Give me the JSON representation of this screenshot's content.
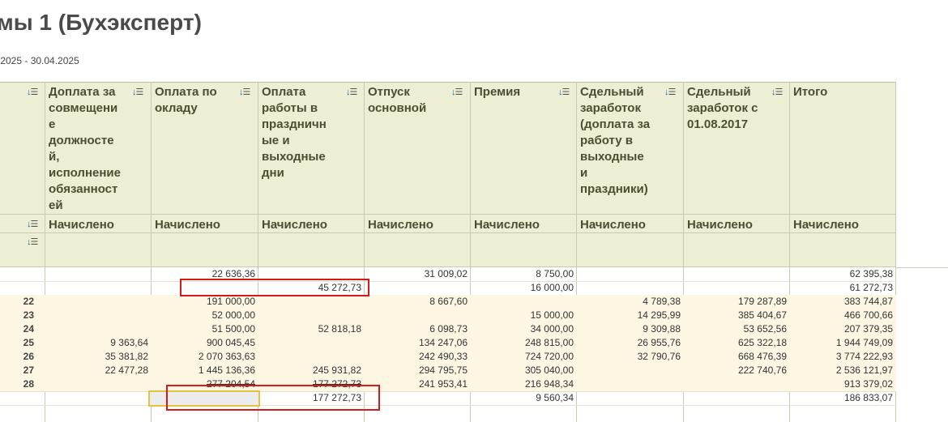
{
  "report": {
    "title": "мы 1 (Бухэксперт)",
    "period": ".2025 - 30.04.2025"
  },
  "columns": [
    {
      "label": "Доплата за\nсовмещени\nе\nдолжносте\nй,\nисполнение\nобязанност\nей",
      "sub": "Начислено"
    },
    {
      "label": "Оплата по\nокладу",
      "sub": "Начислено"
    },
    {
      "label": "Оплата\nработы в\nпраздничн\nые и\nвыходные\nдни",
      "sub": "Начислено"
    },
    {
      "label": "Отпуск\nосновной",
      "sub": "Начислено"
    },
    {
      "label": "Премия",
      "sub": "Начислено"
    },
    {
      "label": "Сдельный\nзаработок\n(доплата за\nработу в\nвыходные\nи\nпраздники)",
      "sub": "Начислено"
    },
    {
      "label": "Сдельный\nзаработок с\n01.08.2017",
      "sub": "Начислено"
    },
    {
      "label": "Итого",
      "sub": "Начислено"
    }
  ],
  "rows": [
    {
      "num": "",
      "values": [
        "",
        "22 636,36",
        "",
        "31 009,02",
        "8 750,00",
        "",
        "",
        "62 395,38"
      ]
    },
    {
      "num": "",
      "values": [
        "",
        "",
        "45 272,73",
        "",
        "16 000,00",
        "",
        "",
        "61 272,73"
      ]
    },
    {
      "num": "22",
      "values": [
        "",
        "191 000,00",
        "",
        "8 667,60",
        "",
        "4 789,38",
        "179 287,89",
        "383 744,87"
      ]
    },
    {
      "num": "23",
      "values": [
        "",
        "52 000,00",
        "",
        "",
        "15 000,00",
        "14 295,99",
        "385 404,67",
        "466 700,66"
      ]
    },
    {
      "num": "24",
      "values": [
        "",
        "51 500,00",
        "52 818,18",
        "6 098,73",
        "34 000,00",
        "9 309,88",
        "53 652,56",
        "207 379,35"
      ]
    },
    {
      "num": "25",
      "values": [
        "9 363,64",
        "900 045,45",
        "",
        "134 247,06",
        "248 815,00",
        "26 955,76",
        "625 322,18",
        "1 944 749,09"
      ]
    },
    {
      "num": "26",
      "values": [
        "35 381,82",
        "2 070 363,63",
        "",
        "242 490,33",
        "724 720,00",
        "32 790,76",
        "668 476,39",
        "3 774 222,93"
      ]
    },
    {
      "num": "27",
      "values": [
        "22 477,28",
        "1 445 136,36",
        "245 931,82",
        "294 795,75",
        "305 040,00",
        "",
        "222 740,76",
        "2 536 121,97"
      ]
    },
    {
      "num": "28",
      "values": [
        "",
        "277 204,54",
        "177 272,73",
        "241 953,41",
        "216 948,34",
        "",
        "",
        "913 379,02"
      ]
    },
    {
      "num": "",
      "values": [
        "",
        "",
        "177 272,73",
        "",
        "9 560,34",
        "",
        "",
        "186 833,07"
      ]
    }
  ]
}
